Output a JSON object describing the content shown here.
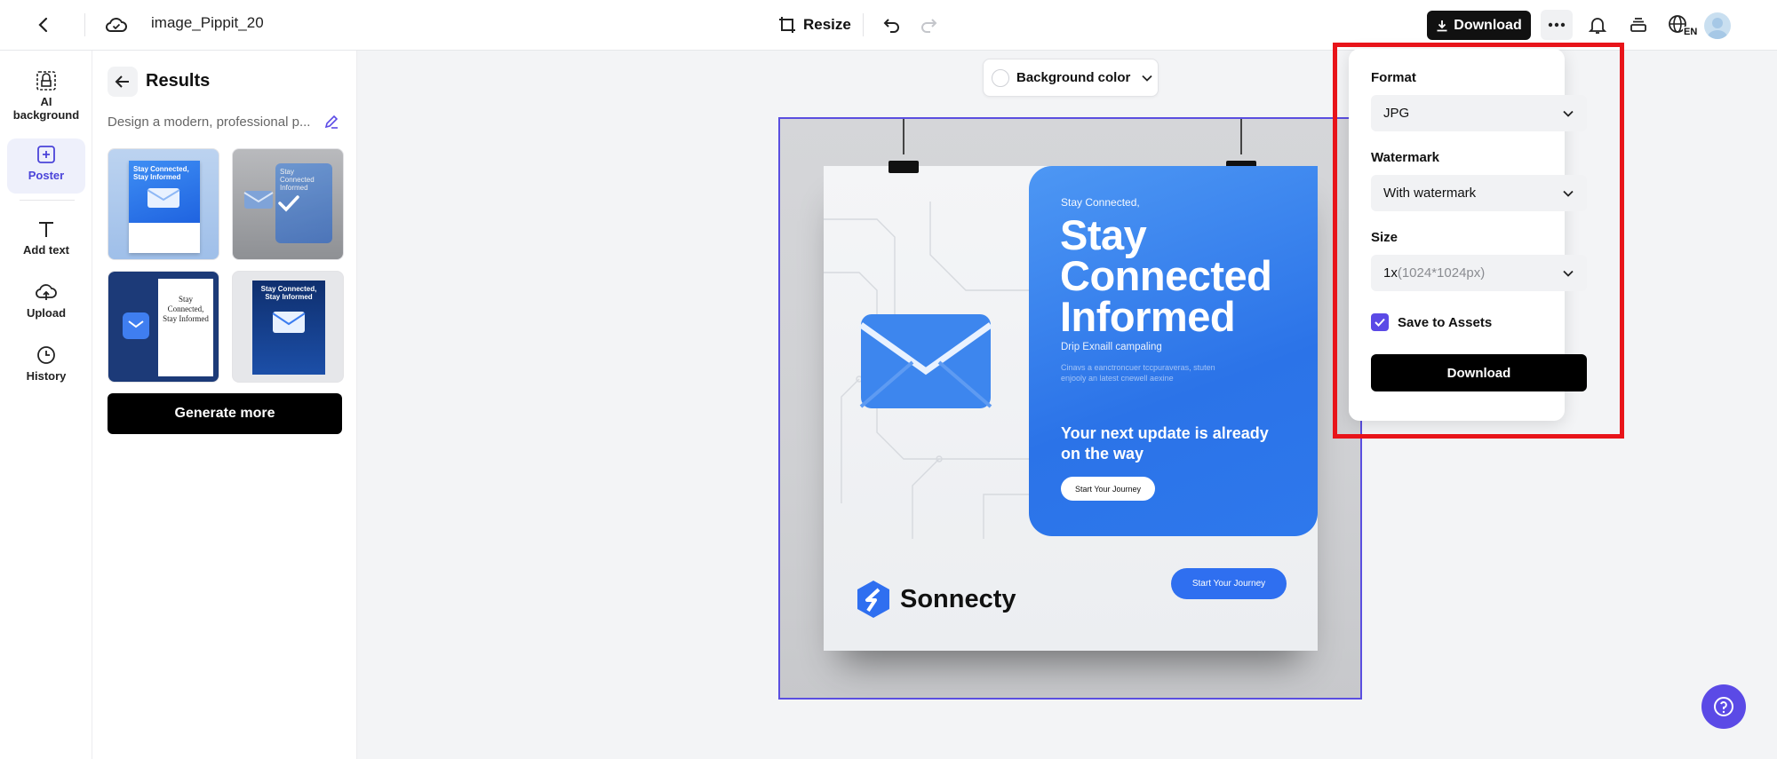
{
  "topbar": {
    "project_title": "image_Pippit_20",
    "resize_label": "Resize",
    "download_label": "Download",
    "language_code": "EN"
  },
  "rail": {
    "items": [
      {
        "label": "AI background",
        "icon": "ai-background-icon"
      },
      {
        "label": "Poster",
        "icon": "poster-icon",
        "active": true
      },
      {
        "label": "Add text",
        "icon": "text-icon"
      },
      {
        "label": "Upload",
        "icon": "upload-icon"
      },
      {
        "label": "History",
        "icon": "history-icon"
      }
    ]
  },
  "results": {
    "title": "Results",
    "prompt": "Design a modern, professional p...",
    "generate_more_label": "Generate more",
    "thumbnails": [
      {
        "caption": "Stay Connected, Stay Informed"
      },
      {
        "caption": "Stay Connected Informed"
      },
      {
        "caption": "Stay Connected, Stay Informed"
      },
      {
        "caption": "Stay Connected, Stay Informed"
      }
    ]
  },
  "canvas": {
    "background_color_label": "Background color"
  },
  "poster": {
    "subtitle": "Stay Connected,",
    "headline_1": "Stay",
    "headline_2": "Connected",
    "headline_3": "Informed",
    "small_line": "Drip Exnaill campaling",
    "tiny_text": "Cinavs a eanctroncuer tccpuraveras, stuten enjooly an latest cnewell aexine",
    "next_update": "Your next update is already on the way",
    "card_button": "Start Your Journey",
    "brand_name": "Sonnecty",
    "cta_button": "Start Your Journey"
  },
  "download_panel": {
    "format_label": "Format",
    "format_value": "JPG",
    "watermark_label": "Watermark",
    "watermark_value": "With watermark",
    "size_label": "Size",
    "size_scale": "1x",
    "size_dims": "(1024*1024px)",
    "save_assets_label": "Save to Assets",
    "save_assets_checked": true,
    "download_button": "Download"
  },
  "colors": {
    "accent": "#5b4ae6",
    "poster_blue": "#2f6ff0",
    "highlight": "#e8141a"
  }
}
